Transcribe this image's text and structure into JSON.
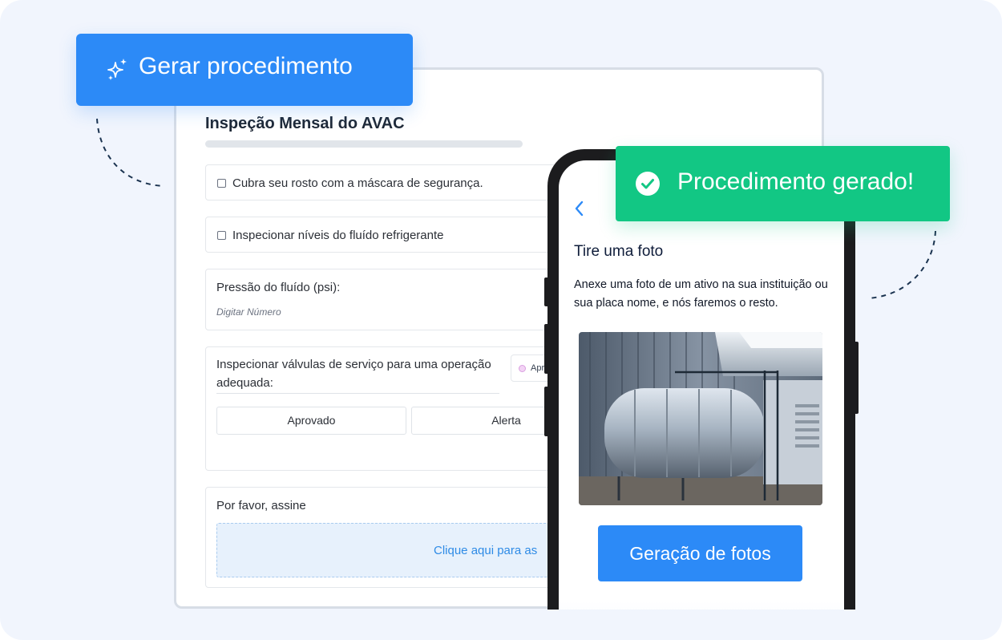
{
  "badges": {
    "generate_label": "Gerar procedimento",
    "generated_label": "Procedimento gerado!"
  },
  "form": {
    "title": "Inspeção Mensal do AVAC",
    "fields": [
      {
        "type": "checkbox",
        "label": "Cubra seu rosto com a máscara de segurança."
      },
      {
        "type": "checkbox",
        "label": "Inspecionar níveis do fluído refrigerante"
      },
      {
        "type": "number",
        "label": "Pressão do fluído (psi):",
        "placeholder": "Digitar Número"
      },
      {
        "type": "choice",
        "label": "Inspecionar válvulas de serviço para uma operação adequada:",
        "options": [
          "Aprovado",
          "Alerta"
        ],
        "chip_text": "Apro"
      },
      {
        "type": "signature",
        "label": "Por favor, assine",
        "action_text": "Clique aqui para as"
      }
    ]
  },
  "phone": {
    "title": "Tire uma foto",
    "description": "Anexe uma foto de um ativo na sua instituição ou sua placa nome, e nós faremos o resto.",
    "cta_label": "Geração de fotos",
    "photo_subject": "hvac-unit-photo"
  },
  "colors": {
    "background": "#f1f5fd",
    "primary_blue": "#2c8af7",
    "success_green": "#12c784",
    "dash_line": "#1b3350"
  }
}
